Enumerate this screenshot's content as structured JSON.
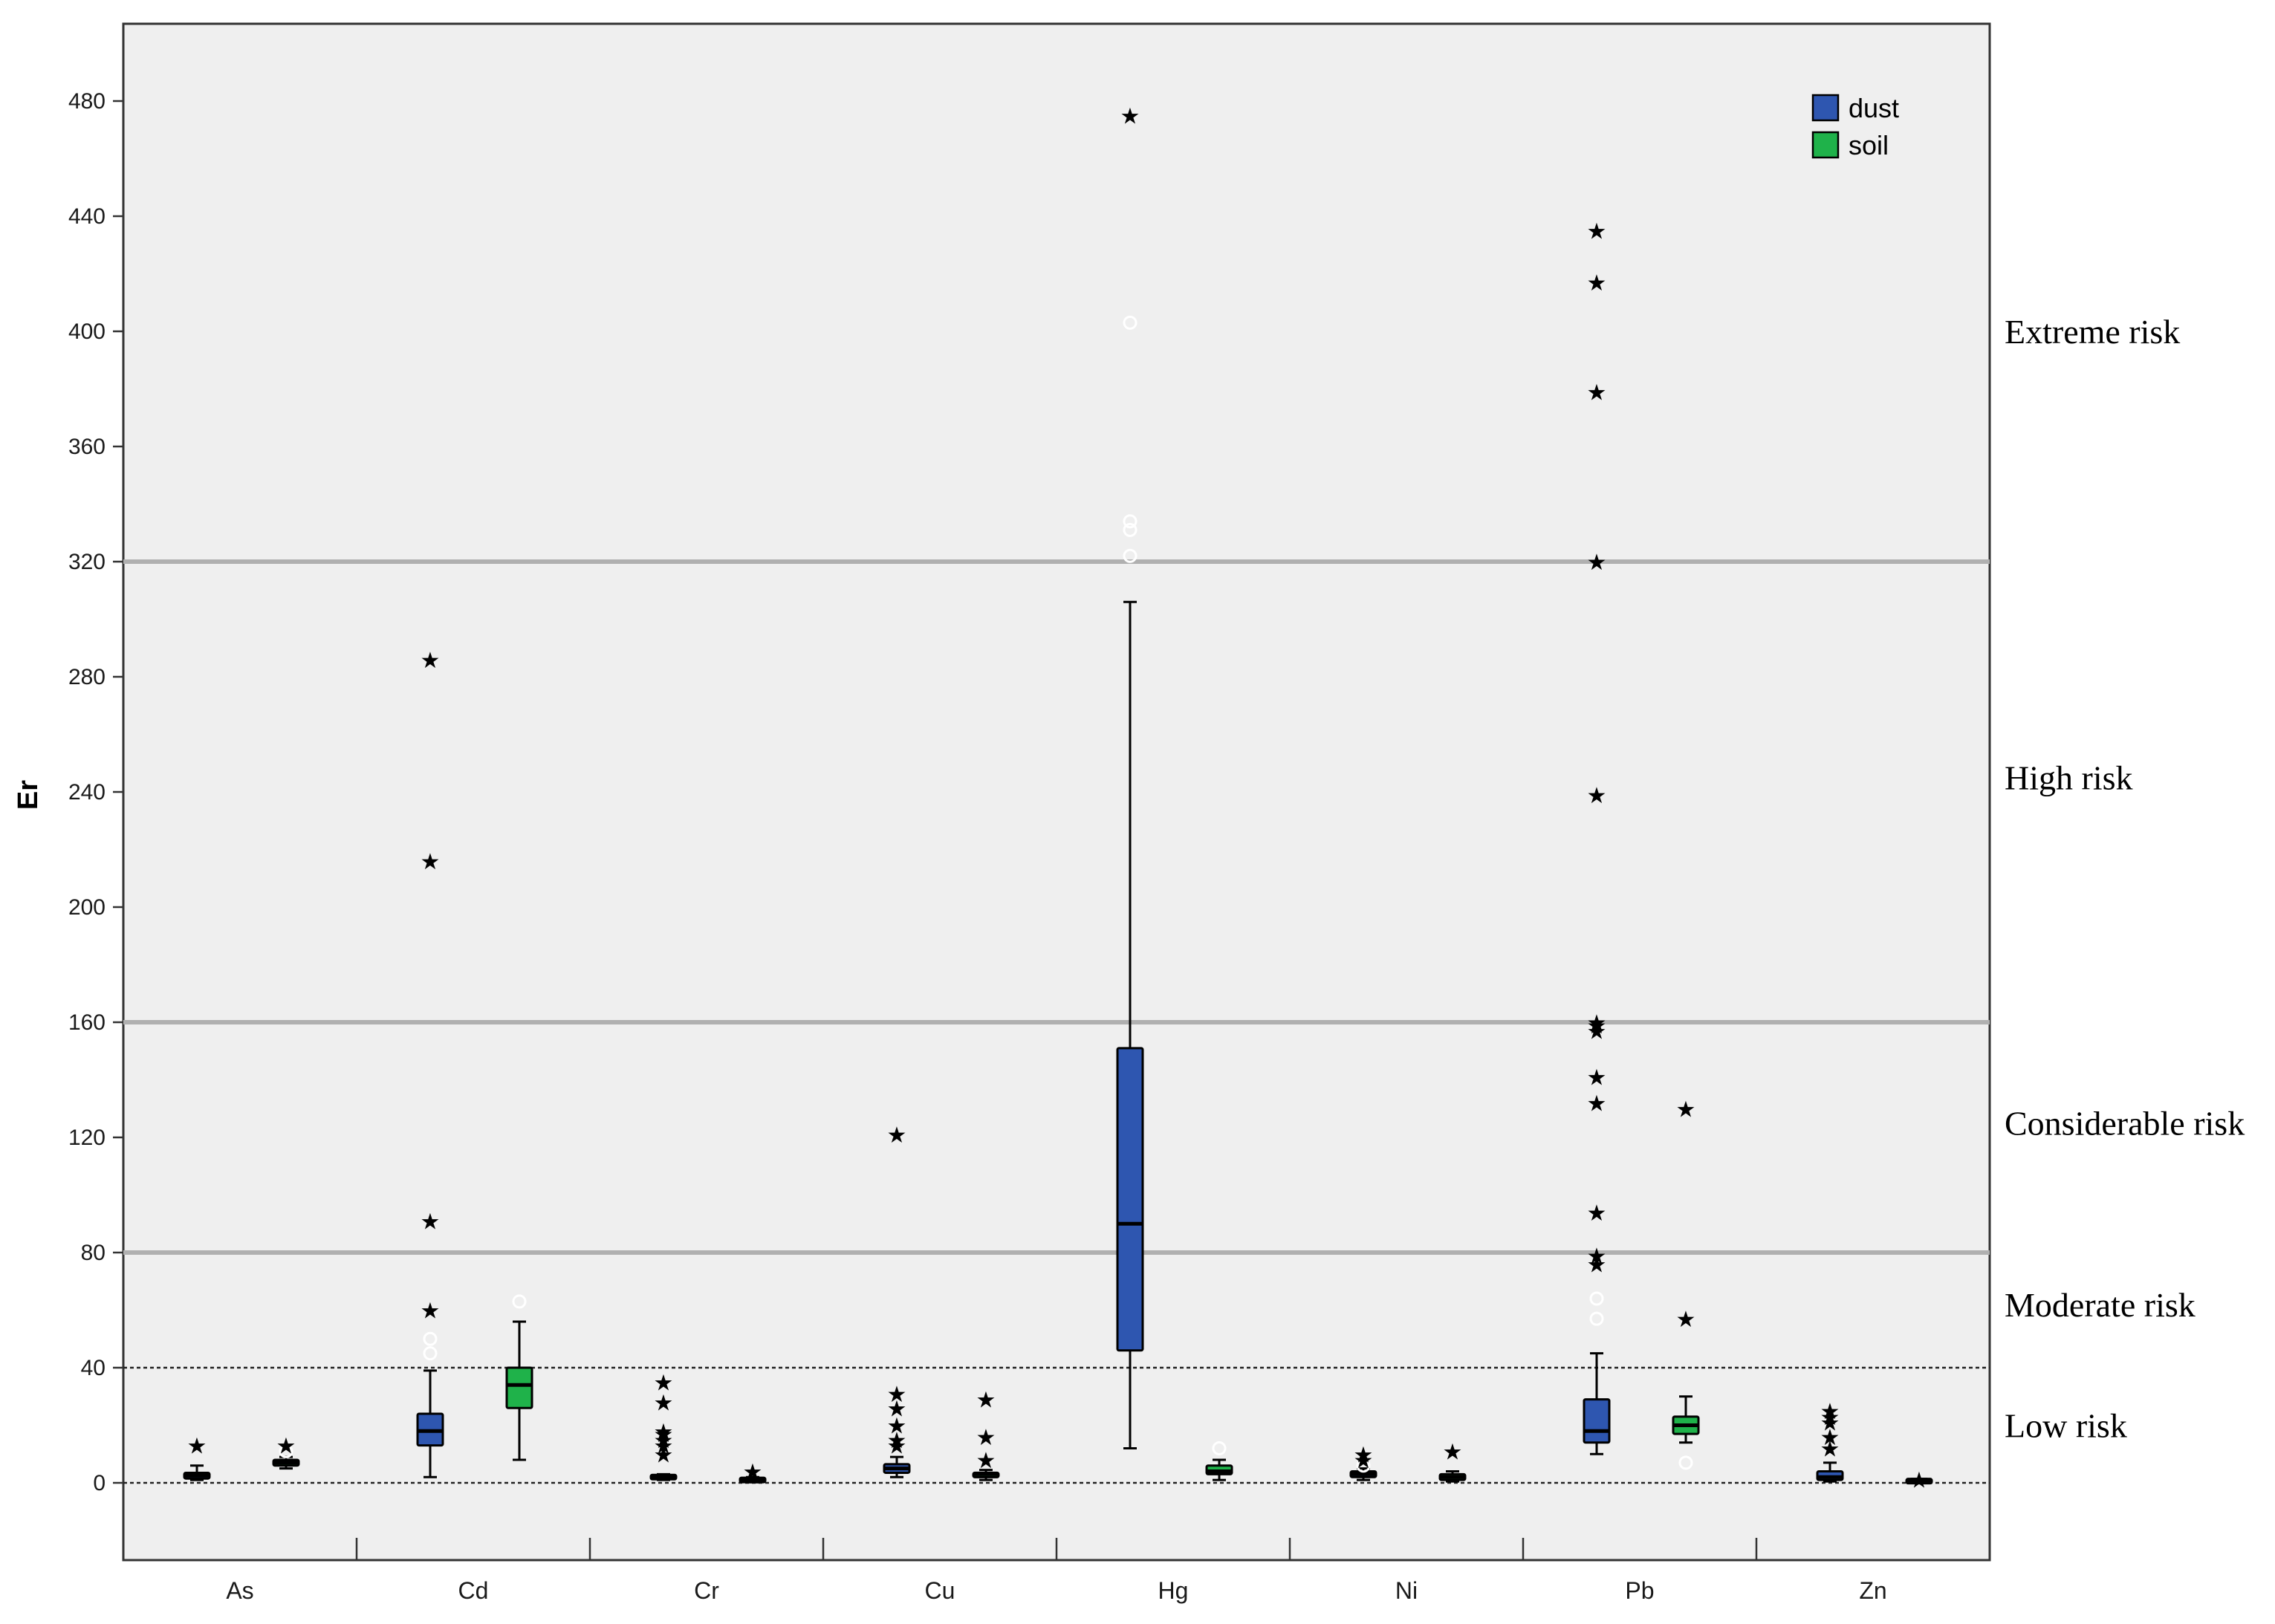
{
  "chart_data": {
    "type": "boxplot",
    "ylabel": "Er",
    "xlabel": "",
    "ylim": [
      -26,
      480
    ],
    "yticks": [
      0,
      40,
      80,
      120,
      160,
      200,
      240,
      280,
      320,
      360,
      400,
      440,
      480
    ],
    "categories": [
      "As",
      "Cd",
      "Cr",
      "Cu",
      "Hg",
      "Ni",
      "Pb",
      "Zn"
    ],
    "grid": false,
    "legend_position": "top-right",
    "series": [
      {
        "name": "dust",
        "color": "#2e56b0",
        "boxes": [
          {
            "category": "As",
            "whisker_low": 1,
            "q1": 1.5,
            "median": 2.5,
            "q3": 3.5,
            "whisker_high": 6,
            "outliers": [],
            "extremes": [
              13
            ]
          },
          {
            "category": "Cd",
            "whisker_low": 2,
            "q1": 13,
            "median": 18,
            "q3": 24,
            "whisker_high": 39,
            "outliers": [
              45,
              50
            ],
            "extremes": [
              60,
              91,
              216,
              286
            ]
          },
          {
            "category": "Cr",
            "whisker_low": 1,
            "q1": 1.5,
            "median": 2,
            "q3": 2.5,
            "whisker_high": 3,
            "outliers": [],
            "extremes": [
              10,
              13,
              15,
              17,
              18,
              28,
              35
            ]
          },
          {
            "category": "Cu",
            "whisker_low": 2,
            "q1": 3.5,
            "median": 5,
            "q3": 6.5,
            "whisker_high": 9,
            "outliers": [],
            "extremes": [
              13,
              15,
              20,
              26,
              31,
              121
            ]
          },
          {
            "category": "Hg",
            "whisker_low": 12,
            "q1": 46,
            "median": 90,
            "q3": 151,
            "whisker_high": 306,
            "outliers": [
              322,
              331,
              334,
              403
            ],
            "extremes": [
              475
            ]
          },
          {
            "category": "Ni",
            "whisker_low": 1,
            "q1": 2,
            "median": 3,
            "q3": 4,
            "whisker_high": 5,
            "outliers": [
              6
            ],
            "extremes": [
              8,
              10
            ]
          },
          {
            "category": "Pb",
            "whisker_low": 10,
            "q1": 14,
            "median": 18,
            "q3": 29,
            "whisker_high": 45,
            "outliers": [
              57,
              64
            ],
            "extremes": [
              76,
              79,
              94,
              132,
              141,
              157,
              159,
              160,
              239,
              320,
              379,
              417,
              435
            ]
          },
          {
            "category": "Zn",
            "whisker_low": 0.5,
            "q1": 1,
            "median": 2,
            "q3": 4,
            "whisker_high": 7,
            "outliers": [],
            "extremes": [
              12,
              16,
              21,
              23,
              25
            ]
          }
        ]
      },
      {
        "name": "soil",
        "color": "#1fb24a",
        "boxes": [
          {
            "category": "As",
            "whisker_low": 5,
            "q1": 6,
            "median": 7,
            "q3": 8,
            "whisker_high": 9,
            "outliers": [
              11
            ],
            "extremes": [
              13
            ]
          },
          {
            "category": "Cd",
            "whisker_low": 8,
            "q1": 26,
            "median": 34,
            "q3": 40,
            "whisker_high": 56,
            "outliers": [
              63
            ],
            "extremes": []
          },
          {
            "category": "Cr",
            "whisker_low": 0.2,
            "q1": 0.5,
            "median": 1,
            "q3": 1.5,
            "whisker_high": 2,
            "outliers": [],
            "extremes": [
              4
            ]
          },
          {
            "category": "Cu",
            "whisker_low": 1,
            "q1": 2,
            "median": 3,
            "q3": 3.5,
            "whisker_high": 4.5,
            "outliers": [],
            "extremes": [
              8,
              16,
              29
            ]
          },
          {
            "category": "Hg",
            "whisker_low": 1,
            "q1": 3,
            "median": 4,
            "q3": 6,
            "whisker_high": 8,
            "outliers": [
              12
            ],
            "extremes": []
          },
          {
            "category": "Ni",
            "whisker_low": 0.5,
            "q1": 1,
            "median": 2,
            "q3": 3,
            "whisker_high": 4,
            "outliers": [],
            "extremes": [
              11
            ]
          },
          {
            "category": "Pb",
            "whisker_low": 14,
            "q1": 17,
            "median": 20,
            "q3": 23,
            "whisker_high": 30,
            "outliers": [
              7
            ],
            "extremes": [
              57,
              130
            ]
          },
          {
            "category": "Zn",
            "whisker_low": 0.2,
            "q1": 0.4,
            "median": 0.6,
            "q3": 0.8,
            "whisker_high": 1,
            "outliers": [],
            "extremes": [
              1.2
            ]
          }
        ]
      }
    ],
    "thresholds": [
      {
        "value": 0,
        "style": "dotted"
      },
      {
        "value": 40,
        "style": "dotted"
      },
      {
        "value": 80,
        "style": "solid"
      },
      {
        "value": 160,
        "style": "solid"
      },
      {
        "value": 320,
        "style": "solid"
      }
    ],
    "risk_zones": [
      {
        "label": "Extreme risk",
        "center": 400
      },
      {
        "label": "High risk",
        "center": 245
      },
      {
        "label": "Considerable risk",
        "center": 125
      },
      {
        "label": "Moderate risk",
        "center": 62
      },
      {
        "label": "Low risk",
        "center": 20
      }
    ]
  }
}
